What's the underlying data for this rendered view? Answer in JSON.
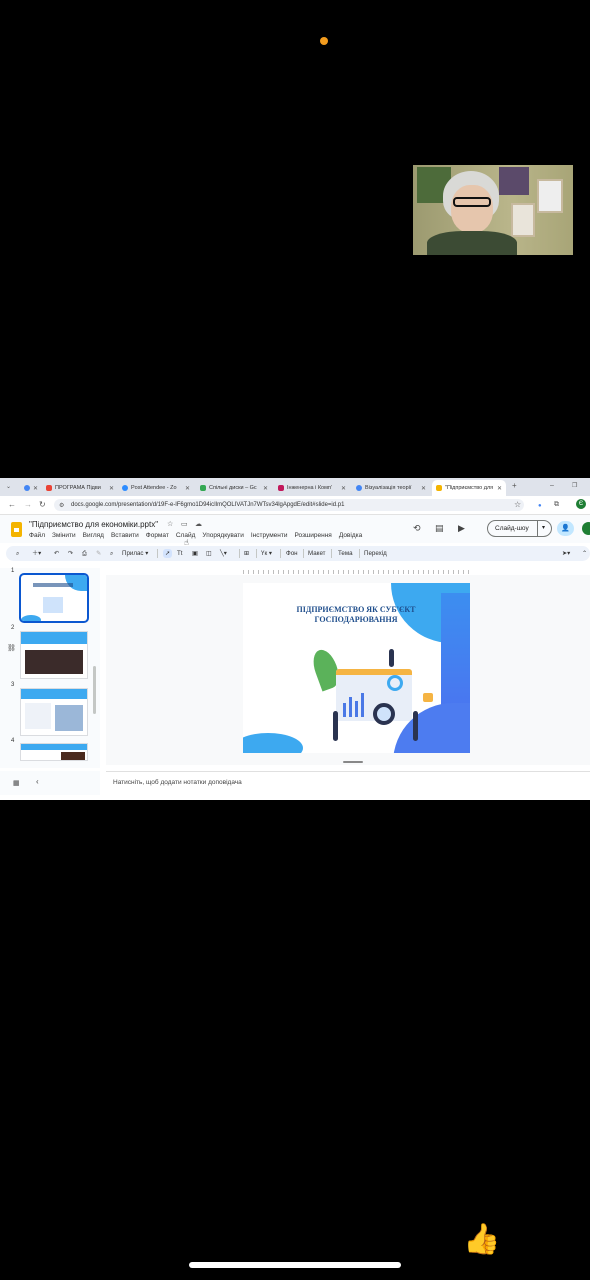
{
  "browser": {
    "tabs": [
      {
        "label": "",
        "fav_color": "#4285f4"
      },
      {
        "label": "ПРОГРАМА Підви",
        "fav_color": "#ea4335"
      },
      {
        "label": "Post Attendee - Zo",
        "fav_color": "#2d8cff"
      },
      {
        "label": "Спільні диски – Gc",
        "fav_color": "#34a853"
      },
      {
        "label": "Інженерна і Комп’",
        "fav_color": "#c2185b"
      },
      {
        "label": "Візуалізація теорії",
        "fav_color": "#4285f4"
      },
      {
        "label": "\"Підприємство для",
        "fav_color": "#f4b400"
      }
    ],
    "url": "docs.google.com/presentation/d/19F-e-lF6gmo1D94icIlmQOLIVATJn7WTsv34lgApgdE/edit#slide=id.p1"
  },
  "app": {
    "doc_title": "\"Підприємство для економіки.pptx\"",
    "menu": [
      "Файл",
      "Змінити",
      "Вигляд",
      "Вставити",
      "Формат",
      "Слайд",
      "Упорядкувати",
      "Інструменти",
      "Розширення",
      "Довідка"
    ],
    "slideshow_label": "Слайд-шоу",
    "avatar_letter": "Є"
  },
  "toolbar": {
    "zoom_label": "Прилас",
    "items": [
      "Фон",
      "Макет",
      "Тема",
      "Перехід"
    ],
    "text_style": "Tt"
  },
  "filmstrip": {
    "numbers": [
      "1",
      "2",
      "3",
      "4"
    ]
  },
  "slide": {
    "title_line1": "ПІДПРИЄМСТВО ЯК СУБ'ЄКТ",
    "title_line2": "ГОСПОДАРЮВАННЯ"
  },
  "notes": {
    "placeholder": "Натисніть, щоб додати нотатки доповідача"
  },
  "colors": {
    "accent": "#0b57d0",
    "slides_brand": "#f4b400",
    "slide_title": "#1f4e8c",
    "recording_dot": "#f39c1e"
  }
}
